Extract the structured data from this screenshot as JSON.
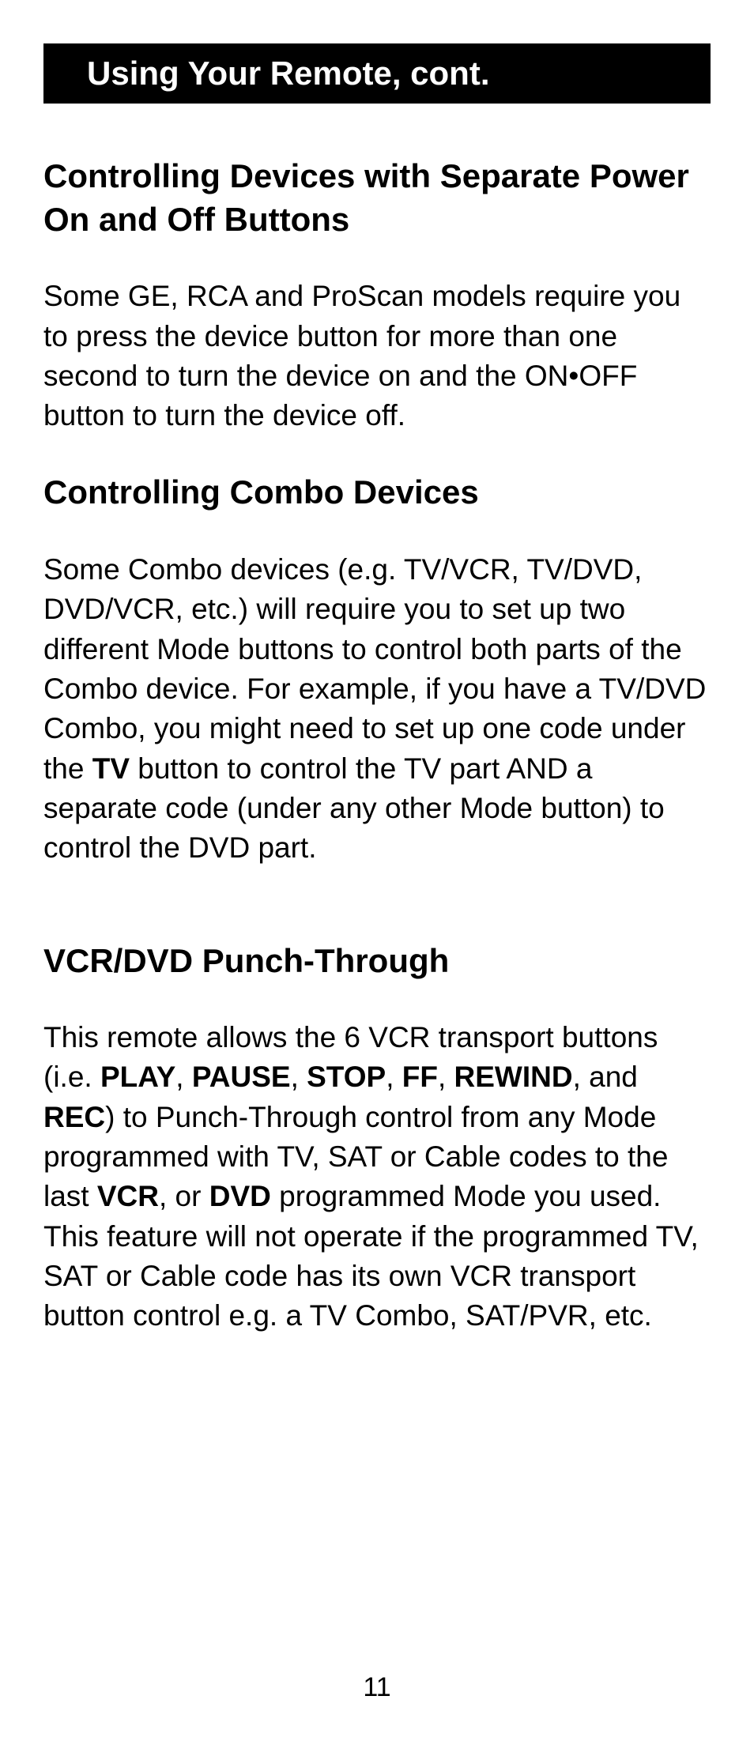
{
  "page_title": "Using Your Remote, cont.",
  "sections": {
    "s1": {
      "heading": "Controlling Devices with Separate Power On and Off Buttons",
      "body": "Some GE, RCA and ProScan models require you to press the device button for more than one second to turn the device on and the ON•OFF button to turn the device off."
    },
    "s2": {
      "heading": "Controlling Combo Devices",
      "body_pre": "Some Combo devices (e.g. TV/VCR, TV/DVD, DVD/VCR, etc.) will require you to set up two different Mode buttons to control both parts of the Combo device. For example, if you have a TV/DVD Combo, you might need to set up one code under the ",
      "tv": "TV",
      "body_post": " button to control the TV part AND a separate code (under any other Mode button) to control the DVD part."
    },
    "s3": {
      "heading": "VCR/DVD Punch-Through",
      "t1": "This remote allows the 6 VCR transport buttons (i.e. ",
      "play": "PLAY",
      "c1": ", ",
      "pause": "PAUSE",
      "c2": ", ",
      "stop": "STOP",
      "c3": ", ",
      "ff": "FF",
      "c4": ", ",
      "rewind": "REWIND",
      "c5": ", and ",
      "rec": "REC",
      "t2": ") to Punch-Through control from any Mode programmed with TV, SAT or Cable codes to the last ",
      "vcr": "VCR",
      "c6": ", or ",
      "dvd": "DVD",
      "t3": " programmed Mode you used. This feature will not operate if the programmed TV, SAT or Cable code has its own VCR transport button control e.g. a TV Combo, SAT/PVR, etc."
    }
  },
  "page_number": "11"
}
